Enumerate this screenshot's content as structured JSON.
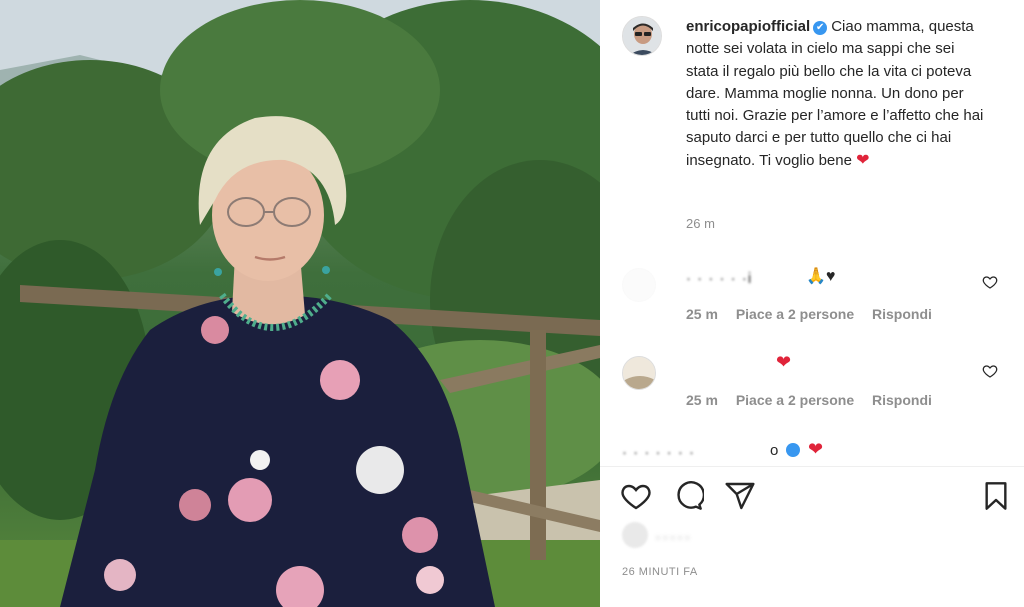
{
  "post": {
    "username": "enricopapiofficial",
    "verified_mark": "✔",
    "caption": "Ciao mamma, questa notte sei volata in cielo ma sappi che sei stata il regalo più bello che la vita ci poteva dare. Mamma moglie nonna. Un dono per tutti noi. Grazie per l’amore e l’affetto che hai saputo darci e per tutto quello che ci hai insegnato. Ti voglio bene",
    "caption_emoji": "❤",
    "time": "26 m"
  },
  "comments": [
    {
      "name_obscured": "i",
      "emoji": "🙏♥",
      "time": "25 m",
      "likes": "Piace a 2 persone",
      "reply": "Rispondi"
    },
    {
      "name_obscured": "",
      "emoji": "❤",
      "time": "25 m",
      "likes": "Piace a 2 persone",
      "reply": "Rispondi"
    },
    {
      "name_obscured": "o",
      "emoji": "❤"
    }
  ],
  "footer": {
    "posted": "26 MINUTI FA"
  },
  "colors": {
    "text": "#262626",
    "muted": "#8e8e8e",
    "verified": "#3897f0",
    "heart": "#e0243a"
  },
  "icons": [
    "heart-icon",
    "comment-icon",
    "share-icon",
    "bookmark-icon",
    "verified-icon"
  ]
}
